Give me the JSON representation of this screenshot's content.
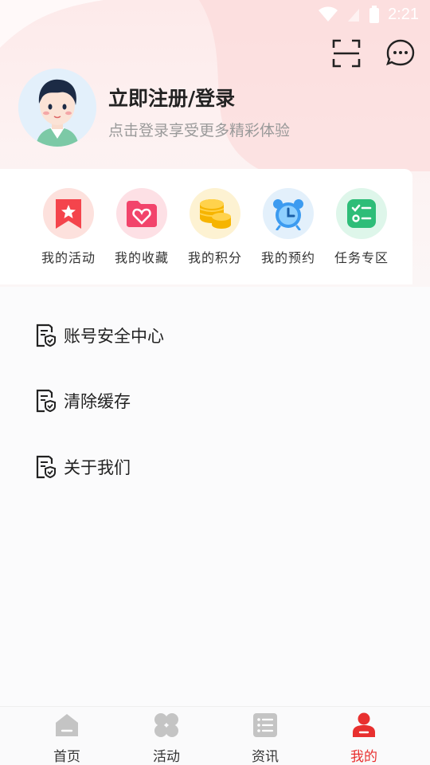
{
  "status_bar": {
    "time": "2:21"
  },
  "profile": {
    "title": "立即注册/登录",
    "subtitle": "点击登录享受更多精彩体验"
  },
  "quick_actions": [
    {
      "label": "我的活动",
      "icon": "bookmark-star-icon",
      "color": "#f4444c",
      "bg": "#fde1dd"
    },
    {
      "label": "我的收藏",
      "icon": "heart-folder-icon",
      "color": "#f2446b",
      "bg": "#fde0e5"
    },
    {
      "label": "我的积分",
      "icon": "coins-icon",
      "color": "#f6b400",
      "bg": "#fdf2d2"
    },
    {
      "label": "我的预约",
      "icon": "alarm-clock-icon",
      "color": "#3c9bf0",
      "bg": "#e3f0fb"
    },
    {
      "label": "任务专区",
      "icon": "task-list-icon",
      "color": "#2ebd78",
      "bg": "#def6ea"
    }
  ],
  "menu": [
    {
      "label": "账号安全中心",
      "icon": "shield-document-icon"
    },
    {
      "label": "清除缓存",
      "icon": "shield-document-icon"
    },
    {
      "label": "关于我们",
      "icon": "shield-document-icon"
    }
  ],
  "bottom_nav": [
    {
      "label": "首页",
      "icon": "home-icon",
      "active": false
    },
    {
      "label": "活动",
      "icon": "clover-icon",
      "active": false
    },
    {
      "label": "资讯",
      "icon": "news-list-icon",
      "active": false
    },
    {
      "label": "我的",
      "icon": "user-icon",
      "active": true
    }
  ],
  "colors": {
    "accent": "#e8302f",
    "inactive_icon": "#c4c4c4"
  }
}
